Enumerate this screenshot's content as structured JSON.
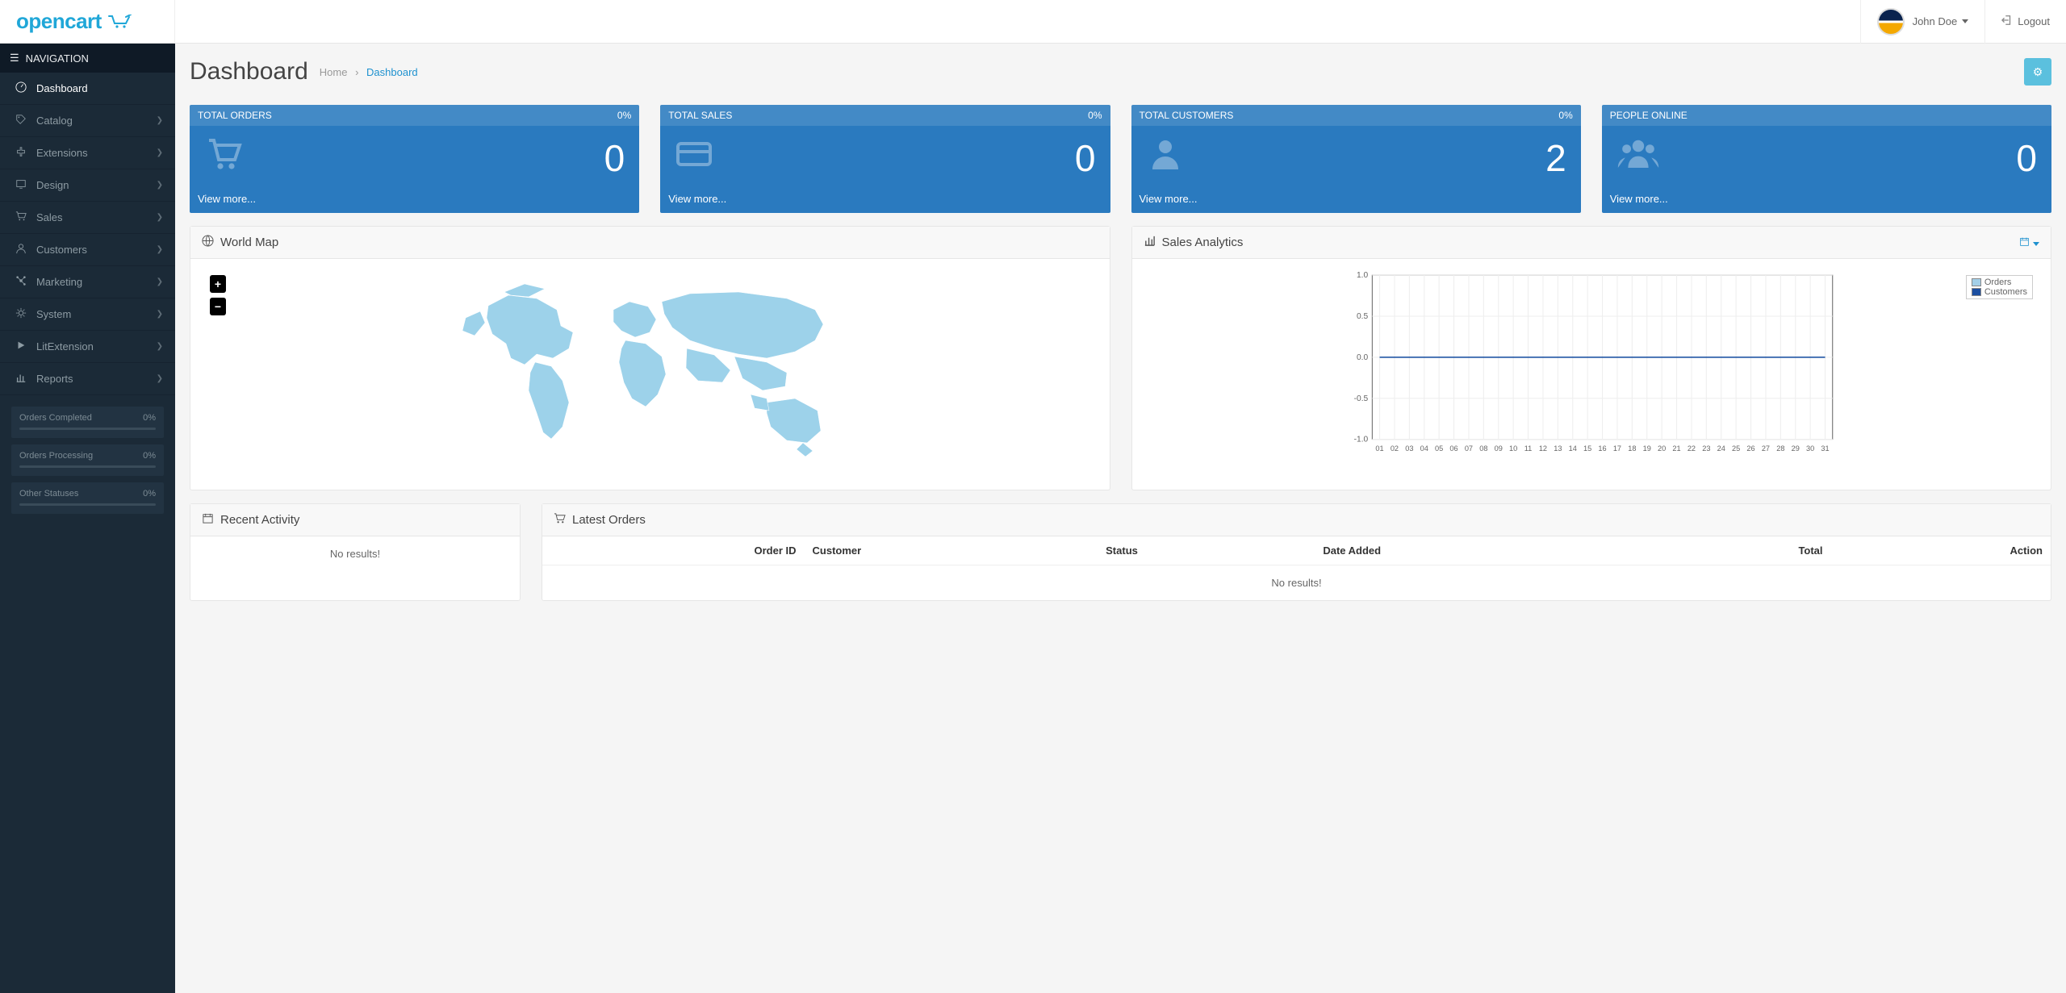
{
  "header": {
    "logo": "opencart",
    "username": "John Doe",
    "logout": "Logout"
  },
  "sidebar": {
    "title": "NAVIGATION",
    "items": [
      {
        "label": "Dashboard",
        "expandable": false,
        "active": true
      },
      {
        "label": "Catalog",
        "expandable": true
      },
      {
        "label": "Extensions",
        "expandable": true
      },
      {
        "label": "Design",
        "expandable": true
      },
      {
        "label": "Sales",
        "expandable": true
      },
      {
        "label": "Customers",
        "expandable": true
      },
      {
        "label": "Marketing",
        "expandable": true
      },
      {
        "label": "System",
        "expandable": true
      },
      {
        "label": "LitExtension",
        "expandable": true
      },
      {
        "label": "Reports",
        "expandable": true
      }
    ],
    "stats": [
      {
        "label": "Orders Completed",
        "value": "0%"
      },
      {
        "label": "Orders Processing",
        "value": "0%"
      },
      {
        "label": "Other Statuses",
        "value": "0%"
      }
    ]
  },
  "page": {
    "title": "Dashboard",
    "breadcrumb_home": "Home",
    "breadcrumb_current": "Dashboard"
  },
  "tiles": [
    {
      "title": "TOTAL ORDERS",
      "pct": "0%",
      "value": "0",
      "link": "View more..."
    },
    {
      "title": "TOTAL SALES",
      "pct": "0%",
      "value": "0",
      "link": "View more..."
    },
    {
      "title": "TOTAL CUSTOMERS",
      "pct": "0%",
      "value": "2",
      "link": "View more..."
    },
    {
      "title": "PEOPLE ONLINE",
      "pct": "",
      "value": "0",
      "link": "View more..."
    }
  ],
  "world_map": {
    "title": "World Map",
    "zoom_in": "+",
    "zoom_out": "−"
  },
  "analytics": {
    "title": "Sales Analytics",
    "legend": [
      "Orders",
      "Customers"
    ]
  },
  "recent": {
    "title": "Recent Activity",
    "empty": "No results!"
  },
  "latest_orders": {
    "title": "Latest Orders",
    "columns": [
      "Order ID",
      "Customer",
      "Status",
      "Date Added",
      "Total",
      "Action"
    ],
    "empty": "No results!"
  },
  "chart_data": {
    "type": "line",
    "title": "Sales Analytics",
    "xlabel": "",
    "ylabel": "",
    "ylim": [
      -1,
      1
    ],
    "yticks": [
      -1.0,
      -0.5,
      0.0,
      0.5,
      1.0
    ],
    "categories": [
      "01",
      "02",
      "03",
      "04",
      "05",
      "06",
      "07",
      "08",
      "09",
      "10",
      "11",
      "12",
      "13",
      "14",
      "15",
      "16",
      "17",
      "18",
      "19",
      "20",
      "21",
      "22",
      "23",
      "24",
      "25",
      "26",
      "27",
      "28",
      "29",
      "30",
      "31"
    ],
    "series": [
      {
        "name": "Orders",
        "color": "#a3cfe8",
        "values": [
          0,
          0,
          0,
          0,
          0,
          0,
          0,
          0,
          0,
          0,
          0,
          0,
          0,
          0,
          0,
          0,
          0,
          0,
          0,
          0,
          0,
          0,
          0,
          0,
          0,
          0,
          0,
          0,
          0,
          0,
          0
        ]
      },
      {
        "name": "Customers",
        "color": "#1b4ea0",
        "values": [
          0,
          0,
          0,
          0,
          0,
          0,
          0,
          0,
          0,
          0,
          0,
          0,
          0,
          0,
          0,
          0,
          0,
          0,
          0,
          0,
          0,
          0,
          0,
          0,
          0,
          0,
          0,
          0,
          0,
          0,
          0
        ]
      }
    ]
  }
}
